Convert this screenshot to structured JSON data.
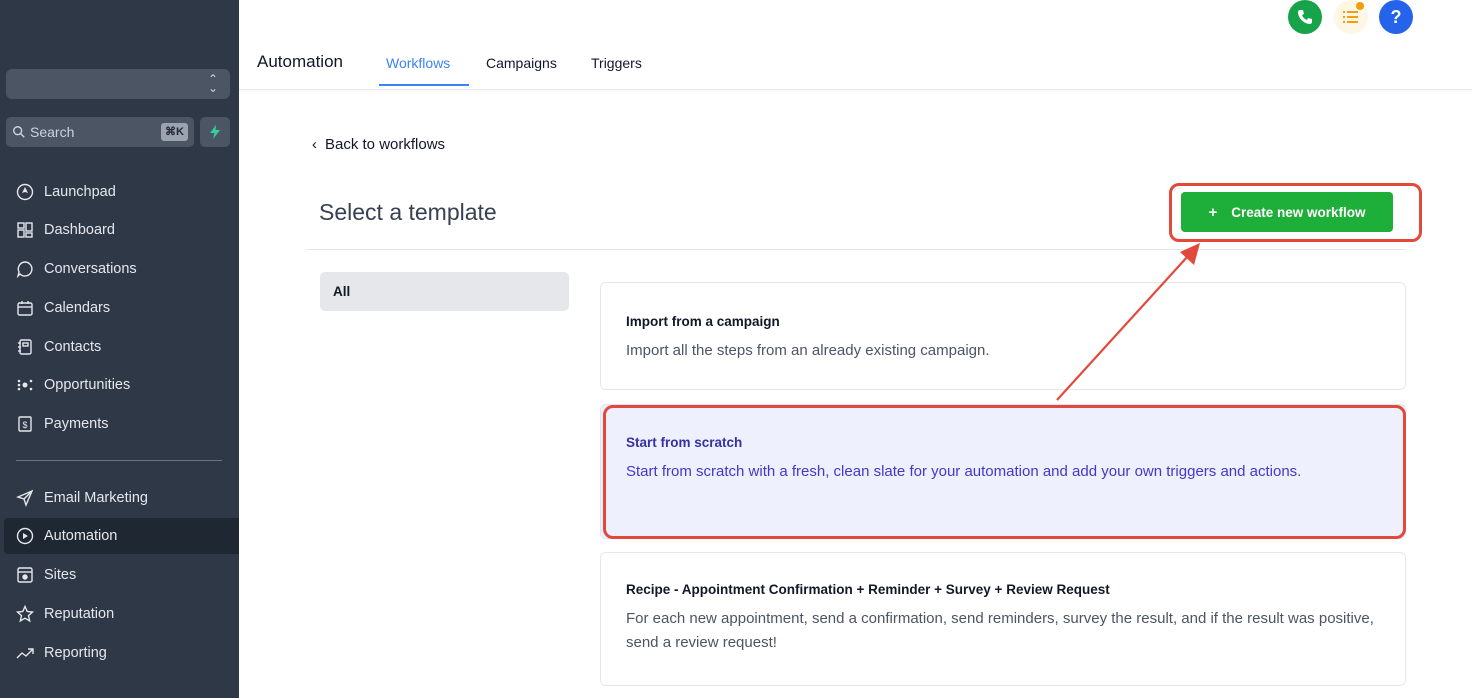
{
  "sidebar": {
    "search": {
      "placeholder": "Search",
      "shortcut": "⌘K"
    },
    "items_top": [
      {
        "label": "Launchpad",
        "icon": "launchpad-icon"
      },
      {
        "label": "Dashboard",
        "icon": "dashboard-icon"
      },
      {
        "label": "Conversations",
        "icon": "chat-bubble-icon"
      },
      {
        "label": "Calendars",
        "icon": "calendar-icon"
      },
      {
        "label": "Contacts",
        "icon": "contacts-icon"
      },
      {
        "label": "Opportunities",
        "icon": "opportunities-icon"
      },
      {
        "label": "Payments",
        "icon": "payments-icon"
      }
    ],
    "items_bottom": [
      {
        "label": "Email Marketing",
        "icon": "paper-plane-icon"
      },
      {
        "label": "Automation",
        "icon": "automation-icon",
        "active": true
      },
      {
        "label": "Sites",
        "icon": "sites-icon"
      },
      {
        "label": "Reputation",
        "icon": "star-icon"
      },
      {
        "label": "Reporting",
        "icon": "trend-icon"
      }
    ]
  },
  "topbar": {
    "title": "Automation",
    "tabs": [
      {
        "label": "Workflows",
        "active": true
      },
      {
        "label": "Campaigns",
        "active": false
      },
      {
        "label": "Triggers",
        "active": false
      }
    ]
  },
  "content": {
    "back_label": "Back to workflows",
    "page_title": "Select a template",
    "create_button": "Create new workflow",
    "filter_label": "All",
    "templates": [
      {
        "title": "Import from a campaign",
        "description": "Import all the steps from an already existing campaign."
      },
      {
        "title": "Start from scratch",
        "description": "Start from scratch with a fresh, clean slate for your automation and add your own triggers and actions."
      },
      {
        "title": "Recipe - Appointment Confirmation + Reminder + Survey + Review Request",
        "description": "For each new appointment, send a confirmation, send reminders, survey the result, and if the result was positive, send a review request!"
      }
    ]
  },
  "colors": {
    "sidebar_bg": "#2f3847",
    "accent_blue": "#3b82f6",
    "create_green": "#1eae3a",
    "annotation_red": "#e2493b",
    "selected_card_bg": "#eef0fd"
  }
}
